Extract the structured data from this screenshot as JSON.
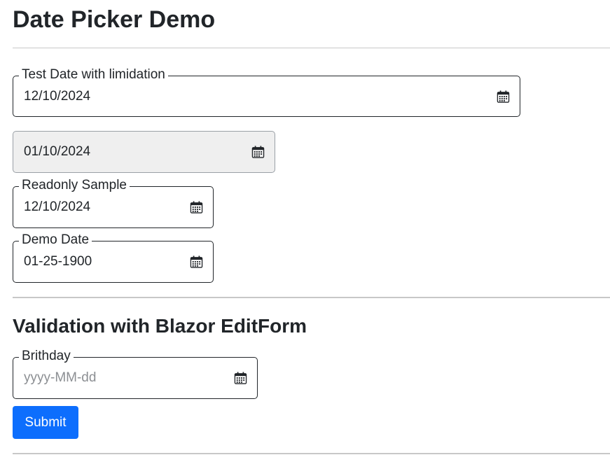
{
  "page": {
    "title": "Date Picker Demo"
  },
  "fields": {
    "test_date": {
      "label": "Test Date with limidation",
      "value": "12/10/2024"
    },
    "disabled_date": {
      "value": "01/10/2024"
    },
    "readonly_sample": {
      "label": "Readonly Sample",
      "value": "12/10/2024"
    },
    "demo_date": {
      "label": "Demo Date",
      "value": "01-25-1900"
    }
  },
  "validation": {
    "title": "Validation with Blazor EditForm",
    "birthday": {
      "label": "Brithday",
      "value": "",
      "placeholder": "yyyy-MM-dd"
    },
    "submit_label": "Submit"
  },
  "icons": {
    "calendar": "calendar-icon"
  },
  "colors": {
    "primary": "#0d6efd",
    "text": "#212529",
    "disabled_bg": "#efefef",
    "placeholder": "#8c8f93",
    "rule": "#c8c8c8"
  }
}
